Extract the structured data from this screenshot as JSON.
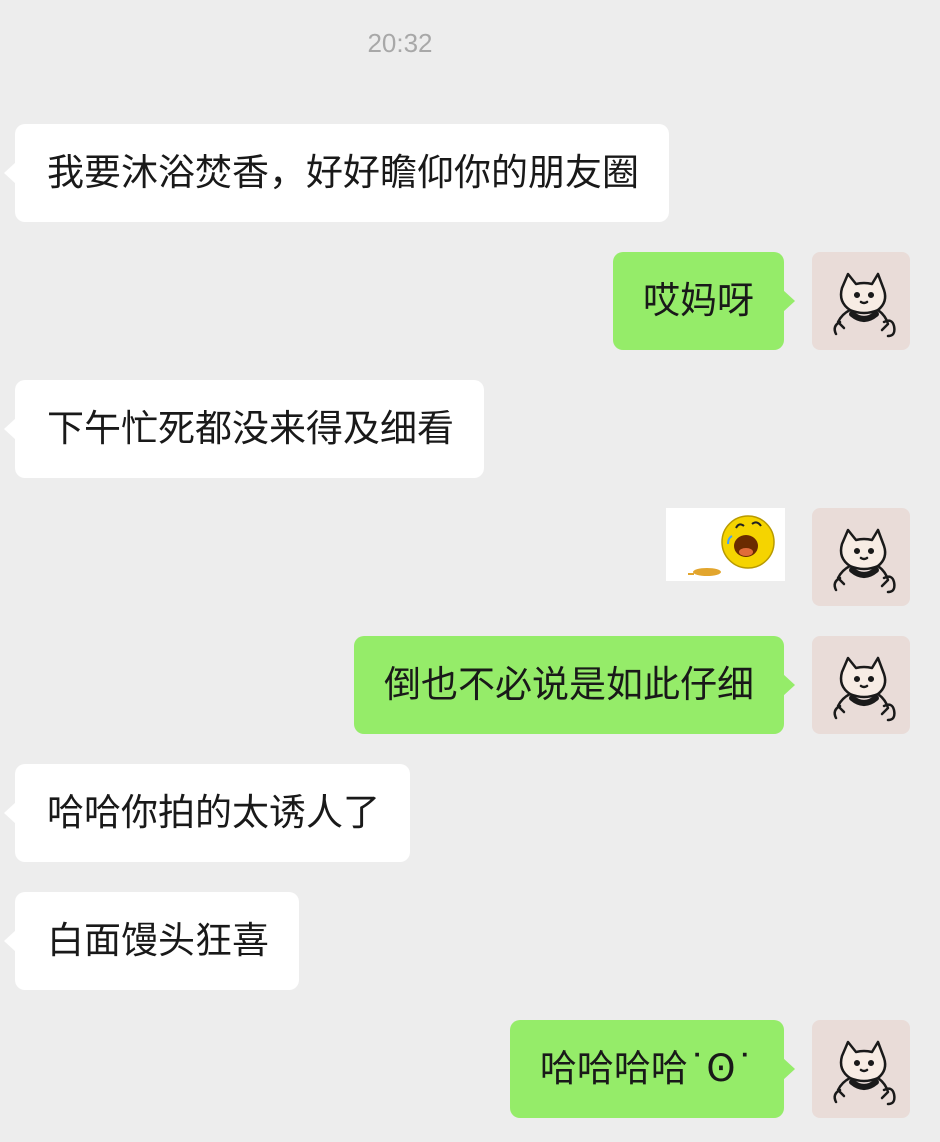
{
  "chat": {
    "timestamp": "20:32",
    "messages": [
      {
        "side": "left",
        "type": "text",
        "text": "我要沐浴焚香，好好瞻仰你的朋友圈"
      },
      {
        "side": "right",
        "type": "text",
        "text": "哎妈呀"
      },
      {
        "side": "left",
        "type": "text",
        "text": "下午忙死都没来得及细看"
      },
      {
        "side": "right",
        "type": "sticker",
        "sticker": "laughing-emoji-sticker"
      },
      {
        "side": "right",
        "type": "text",
        "text": "倒也不必说是如此仔细"
      },
      {
        "side": "left",
        "type": "text",
        "text": "哈哈你拍的太诱人了"
      },
      {
        "side": "left",
        "type": "text",
        "text": "白面馒头狂喜"
      },
      {
        "side": "right",
        "type": "text",
        "text": "哈哈哈哈˙Ꙩ˙"
      }
    ]
  },
  "colors": {
    "background": "#ededed",
    "incoming_bubble": "#ffffff",
    "outgoing_bubble": "#95ec69",
    "avatar_background": "#e9dcd8"
  }
}
